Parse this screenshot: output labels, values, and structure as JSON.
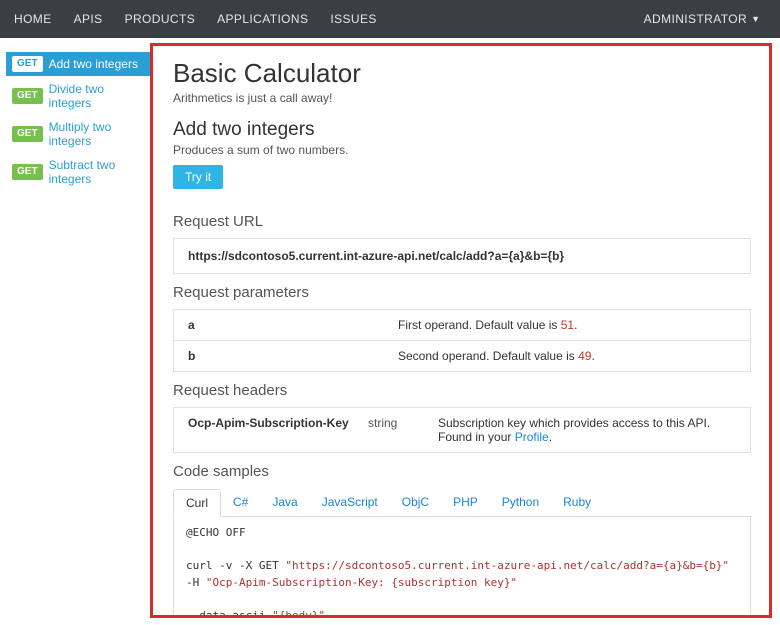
{
  "nav": {
    "items": [
      "HOME",
      "APIS",
      "PRODUCTS",
      "APPLICATIONS",
      "ISSUES"
    ],
    "right": "ADMINISTRATOR"
  },
  "sidebar": {
    "items": [
      {
        "method": "GET",
        "label": "Add two integers",
        "active": true
      },
      {
        "method": "GET",
        "label": "Divide two integers",
        "active": false
      },
      {
        "method": "GET",
        "label": "Multiply two integers",
        "active": false
      },
      {
        "method": "GET",
        "label": "Subtract two integers",
        "active": false
      }
    ]
  },
  "page": {
    "title": "Basic Calculator",
    "subtitle": "Arithmetics is just a call away!",
    "op_title": "Add two integers",
    "op_desc": "Produces a sum of two numbers.",
    "tryit": "Try it"
  },
  "sections": {
    "request_url": "Request URL",
    "request_params": "Request parameters",
    "request_headers": "Request headers",
    "code_samples": "Code samples"
  },
  "url": "https://sdcontoso5.current.int-azure-api.net/calc/add?a={a}&b={b}",
  "params": [
    {
      "name": "a",
      "desc_pre": "First operand. Default value is ",
      "default": "51",
      "desc_post": "."
    },
    {
      "name": "b",
      "desc_pre": "Second operand. Default value is ",
      "default": "49",
      "desc_post": "."
    }
  ],
  "headers": [
    {
      "name": "Ocp-Apim-Subscription-Key",
      "type": "string",
      "desc": "Subscription key which provides access to this API. Found in your ",
      "link": "Profile",
      "post": "."
    }
  ],
  "code_tabs": [
    "Curl",
    "C#",
    "Java",
    "JavaScript",
    "ObjC",
    "PHP",
    "Python",
    "Ruby"
  ],
  "code": {
    "line1": "@ECHO OFF",
    "line2a": "curl -v -X GET ",
    "line2b": "\"https://sdcontoso5.current.int-azure-api.net/calc/add?a={a}&b={b}\"",
    "line3a": "-H ",
    "line3b": "\"Ocp-Apim-Subscription-Key: {subscription key}\"",
    "line4a": "--data-ascii ",
    "line4b": "\"{body}\""
  }
}
